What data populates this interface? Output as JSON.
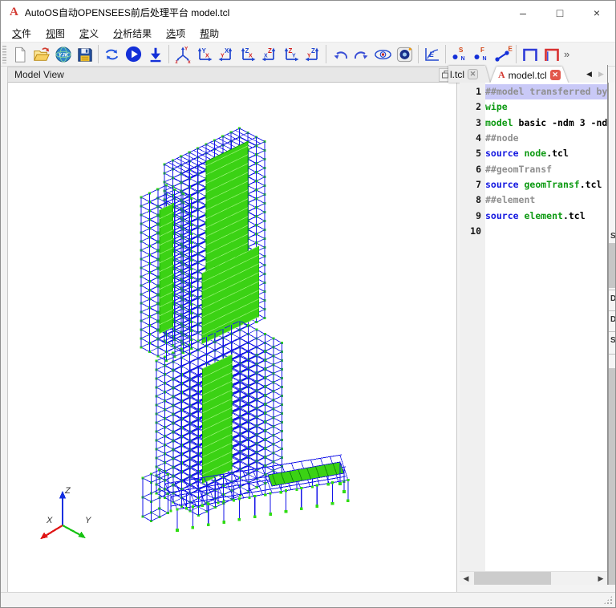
{
  "window": {
    "title": "AutoOS自动OPENSEES前后处理平台 model.tcl",
    "logo": "A",
    "controls": {
      "minimize": "–",
      "maximize": "□",
      "close": "×"
    }
  },
  "menu": {
    "items": [
      {
        "key": "文",
        "rest": "件"
      },
      {
        "key": "视",
        "rest": "图"
      },
      {
        "key": "定",
        "rest": "义"
      },
      {
        "key": "分",
        "rest": "析结果"
      },
      {
        "key": "选",
        "rest": "项"
      },
      {
        "key": "帮",
        "rest": "助"
      }
    ]
  },
  "toolbar": {
    "icon_names": [
      "new-file",
      "open-file",
      "yjk-import",
      "save",
      "sync-model",
      "run-analysis",
      "download-results",
      "axes-3d",
      "view-yx",
      "view-xy",
      "view-zx",
      "view-xz",
      "view-zy",
      "view-yz",
      "undo",
      "redo",
      "show-view",
      "snapshot",
      "result-curve",
      "node-start-marker",
      "node-force-marker",
      "element-marker",
      "frame-blue",
      "frame-red"
    ],
    "yjk_label": "YJK",
    "chart_letter": "E",
    "overflow": "»",
    "axis3d": {
      "up": "Y",
      "left": "z",
      "right": "x"
    },
    "view_icons": [
      {
        "big": "Y",
        "small": "X"
      },
      {
        "big": "X",
        "small": "Y"
      },
      {
        "big": "Z",
        "small": "X"
      },
      {
        "big": "Z",
        "small": "X"
      },
      {
        "big": "Z",
        "small": "Y"
      },
      {
        "big": "Z",
        "small": "Y"
      }
    ],
    "marker_icons": [
      {
        "big": "S",
        "small": "N"
      },
      {
        "big": "F",
        "small": "N"
      },
      {
        "big": "E",
        "small": ""
      }
    ]
  },
  "model_view": {
    "title": "Model View",
    "axes": {
      "x": "X",
      "y": "Y",
      "z": "Z"
    },
    "colors": {
      "frame": "#1515e8",
      "node": "#2fdc12",
      "shell": "#3bd214",
      "axis_x": "#e01414",
      "axis_y": "#16c211",
      "axis_z": "#1430e0"
    }
  },
  "editor": {
    "tabs": [
      {
        "label": "l.tcl",
        "active": false,
        "partial": true
      },
      {
        "label": "model.tcl",
        "active": true
      }
    ],
    "close_glyph": "✕",
    "lines": [
      {
        "n": "1",
        "selected": true,
        "tokens": [
          {
            "t": "##model transferred by",
            "c": "com"
          }
        ]
      },
      {
        "n": "2",
        "selected": false,
        "tokens": [
          {
            "t": "wipe",
            "c": "kw2"
          }
        ]
      },
      {
        "n": "3",
        "selected": false,
        "tokens": [
          {
            "t": "model",
            "c": "kw2"
          },
          {
            "t": " basic -ndm 3 -nd",
            "c": "pl"
          }
        ]
      },
      {
        "n": "4",
        "selected": false,
        "tokens": [
          {
            "t": "##node",
            "c": "com"
          }
        ]
      },
      {
        "n": "5",
        "selected": false,
        "tokens": [
          {
            "t": "source",
            "c": "kw1"
          },
          {
            "t": " ",
            "c": "pl"
          },
          {
            "t": "node",
            "c": "kw2"
          },
          {
            "t": ".tcl",
            "c": "pl"
          }
        ]
      },
      {
        "n": "6",
        "selected": false,
        "tokens": [
          {
            "t": "##geomTransf",
            "c": "com"
          }
        ]
      },
      {
        "n": "7",
        "selected": false,
        "tokens": [
          {
            "t": "source",
            "c": "kw1"
          },
          {
            "t": " ",
            "c": "pl"
          },
          {
            "t": "geomTransf",
            "c": "kw2"
          },
          {
            "t": ".tcl",
            "c": "pl"
          }
        ]
      },
      {
        "n": "8",
        "selected": false,
        "tokens": [
          {
            "t": "##element",
            "c": "com"
          }
        ]
      },
      {
        "n": "9",
        "selected": false,
        "tokens": [
          {
            "t": "source",
            "c": "kw1"
          },
          {
            "t": " ",
            "c": "pl"
          },
          {
            "t": "element",
            "c": "kw2"
          },
          {
            "t": ".tcl",
            "c": "pl"
          }
        ]
      },
      {
        "n": "10",
        "selected": false,
        "tokens": []
      }
    ]
  },
  "right_sliver": {
    "fragments": [
      "S",
      "D",
      "D",
      "S"
    ]
  }
}
